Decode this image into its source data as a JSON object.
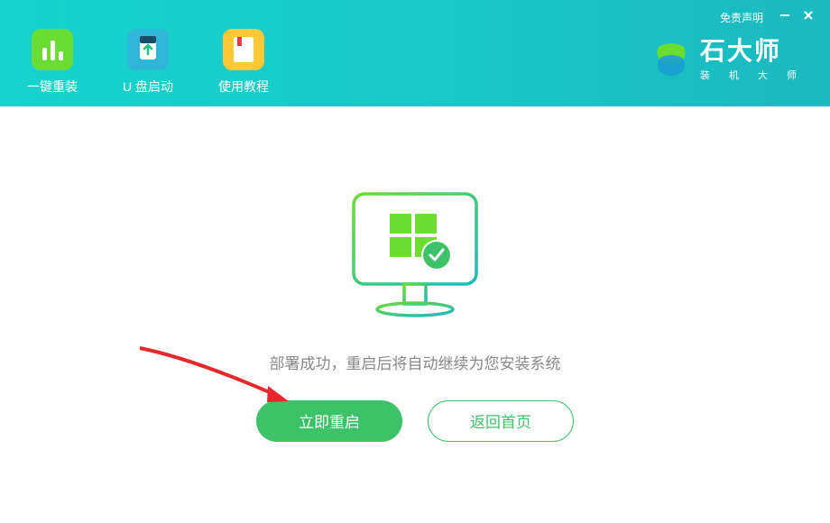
{
  "header": {
    "tabs": [
      {
        "label": "一键重装",
        "active": true
      },
      {
        "label": "U 盘启动",
        "active": false
      },
      {
        "label": "使用教程",
        "active": false
      }
    ],
    "disclaimer_label": "免责声明",
    "logo": {
      "name": "石大师",
      "tagline": "装 机 大 师"
    }
  },
  "main": {
    "status_message": "部署成功，重启后将自动继续为您安装系统",
    "primary_button_label": "立即重启",
    "secondary_button_label": "返回首页"
  },
  "colors": {
    "header_gradient_start": "#17d3cd",
    "header_gradient_end": "#1bb9c0",
    "primary_green": "#3dc169",
    "active_tab_green": "#6bdc32"
  }
}
